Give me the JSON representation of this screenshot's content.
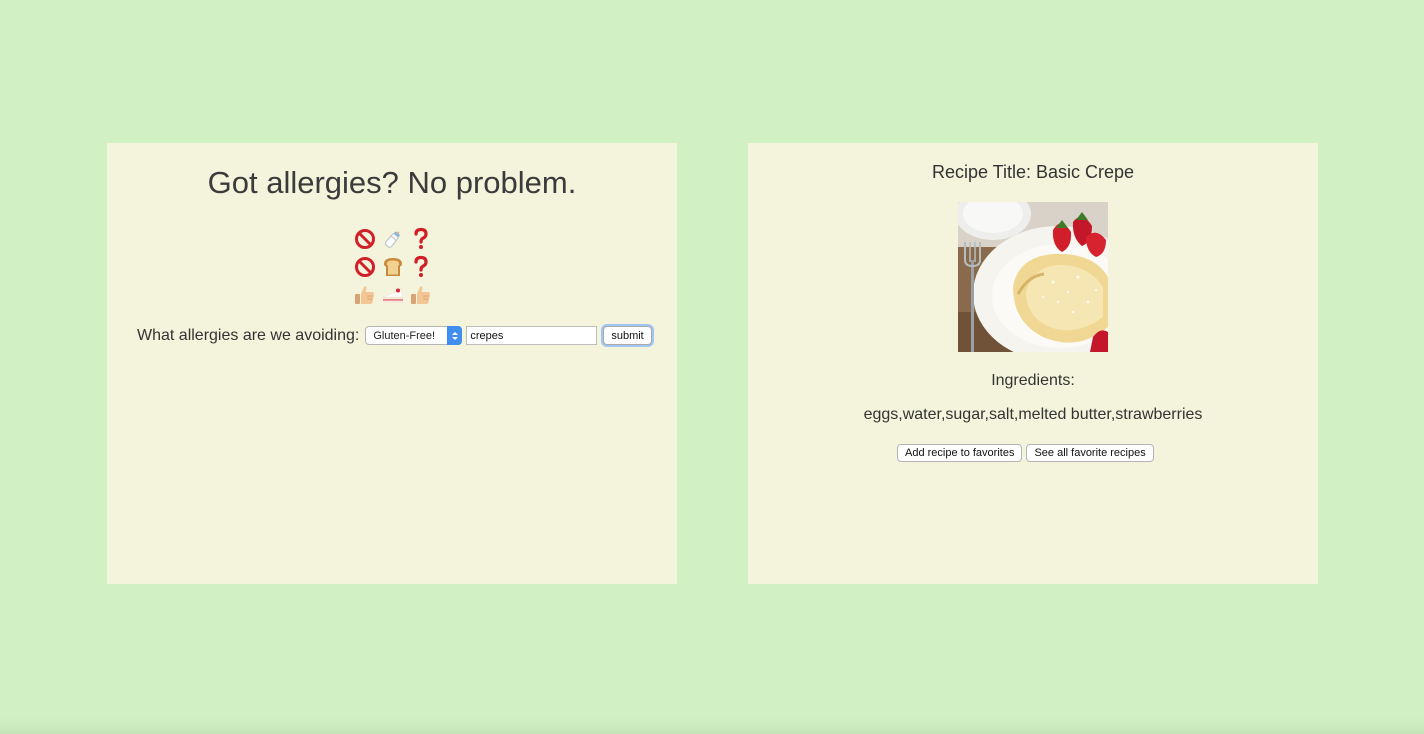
{
  "search_panel": {
    "headline": "Got allergies? No problem.",
    "emoji_rows": [
      [
        "prohibited-icon",
        "baby-bottle-icon",
        "question-mark-icon"
      ],
      [
        "prohibited-icon",
        "bread-icon",
        "question-mark-icon"
      ],
      [
        "thumbs-up-icon",
        "cake-slice-icon",
        "thumbs-up-icon"
      ]
    ],
    "prompt_label": "What allergies are we avoiding:",
    "allergy_select": {
      "selected": "Gluten-Free!"
    },
    "search_input": {
      "value": "crepes"
    },
    "submit_label": "submit"
  },
  "recipe_panel": {
    "title": "Recipe Title: Basic Crepe",
    "ingredients_label": "Ingredients:",
    "ingredients": "eggs,water,sugar,salt,melted butter,strawberries",
    "add_favorite_label": "Add recipe to favorites",
    "see_favorites_label": "See all favorite recipes"
  },
  "colors": {
    "page_background": "#d1f0c4",
    "panel_background": "#f4f4dc",
    "select_accent": "#3f8ef0"
  }
}
